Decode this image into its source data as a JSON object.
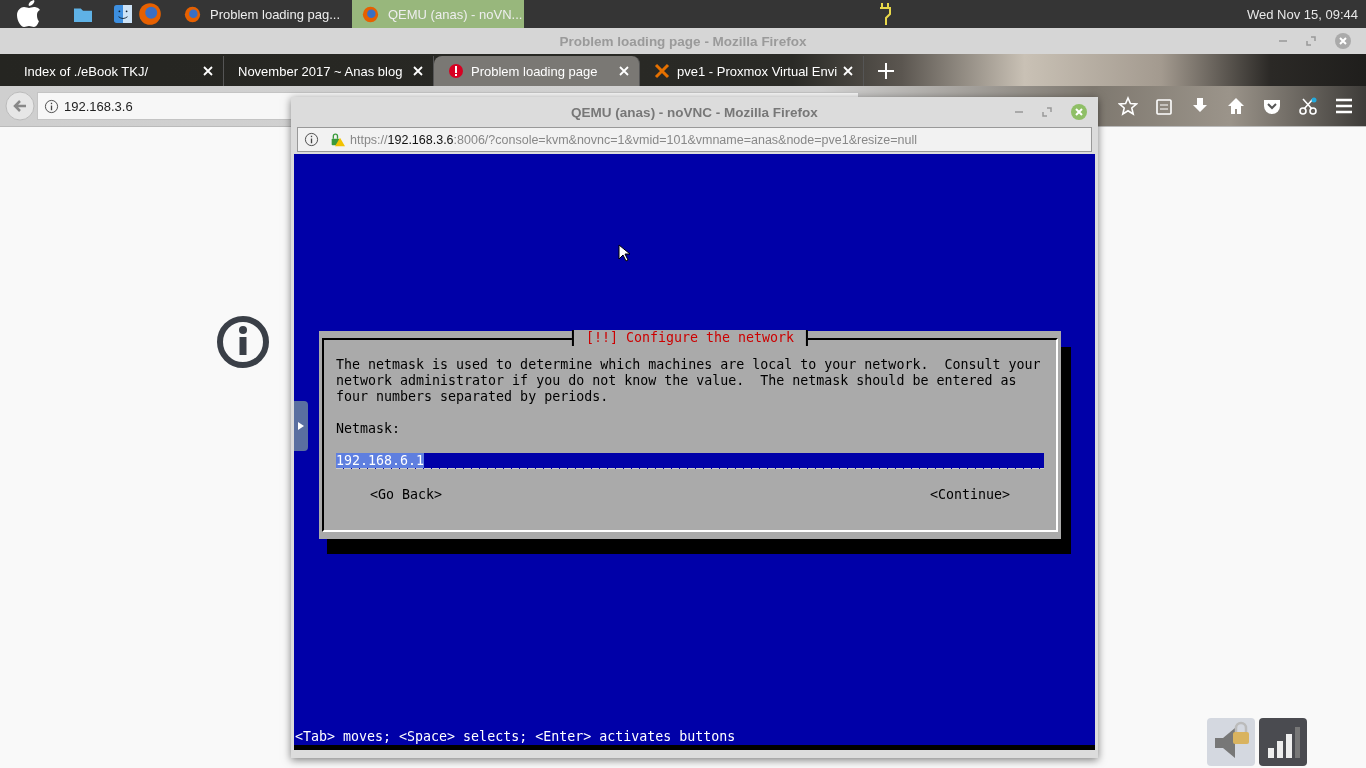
{
  "top_panel": {
    "taskbar": [
      {
        "label": "Problem loading pag...",
        "selected": false
      },
      {
        "label": "QEMU (anas) - noVN...",
        "selected": true
      }
    ],
    "clock": "Wed Nov 15, 09:44"
  },
  "browser": {
    "title": "Problem loading page - Mozilla Firefox",
    "tabs": [
      {
        "label": "Index of ./eBook TKJ/",
        "selected": false,
        "kind": "plain"
      },
      {
        "label": "November 2017 ~ Anas blog",
        "selected": false,
        "kind": "plain"
      },
      {
        "label": "Problem loading page",
        "selected": true,
        "kind": "error"
      },
      {
        "label": "pve1 - Proxmox Virtual Envi",
        "selected": false,
        "kind": "proxmox"
      }
    ],
    "address": "192.168.3.6"
  },
  "popup": {
    "title": "QEMU (anas) - noVNC - Mozilla Firefox",
    "url": {
      "scheme": "https://",
      "host": "192.168.3.6",
      "rest": ":8006/?console=kvm&novnc=1&vmid=101&vmname=anas&node=pve1&resize=null"
    },
    "dialog": {
      "title": "[!!] Configure the network",
      "message": "The netmask is used to determine which machines are local to your network.  Consult your network administrator if you do not know the value.  The netmask should be entered as four numbers separated by periods.",
      "field_label": "Netmask:",
      "value": "192.168.6.1",
      "buttons": [
        "<Go Back>",
        "<Continue>"
      ]
    },
    "help_line": "<Tab> moves; <Space> selects; <Enter> activates buttons"
  }
}
